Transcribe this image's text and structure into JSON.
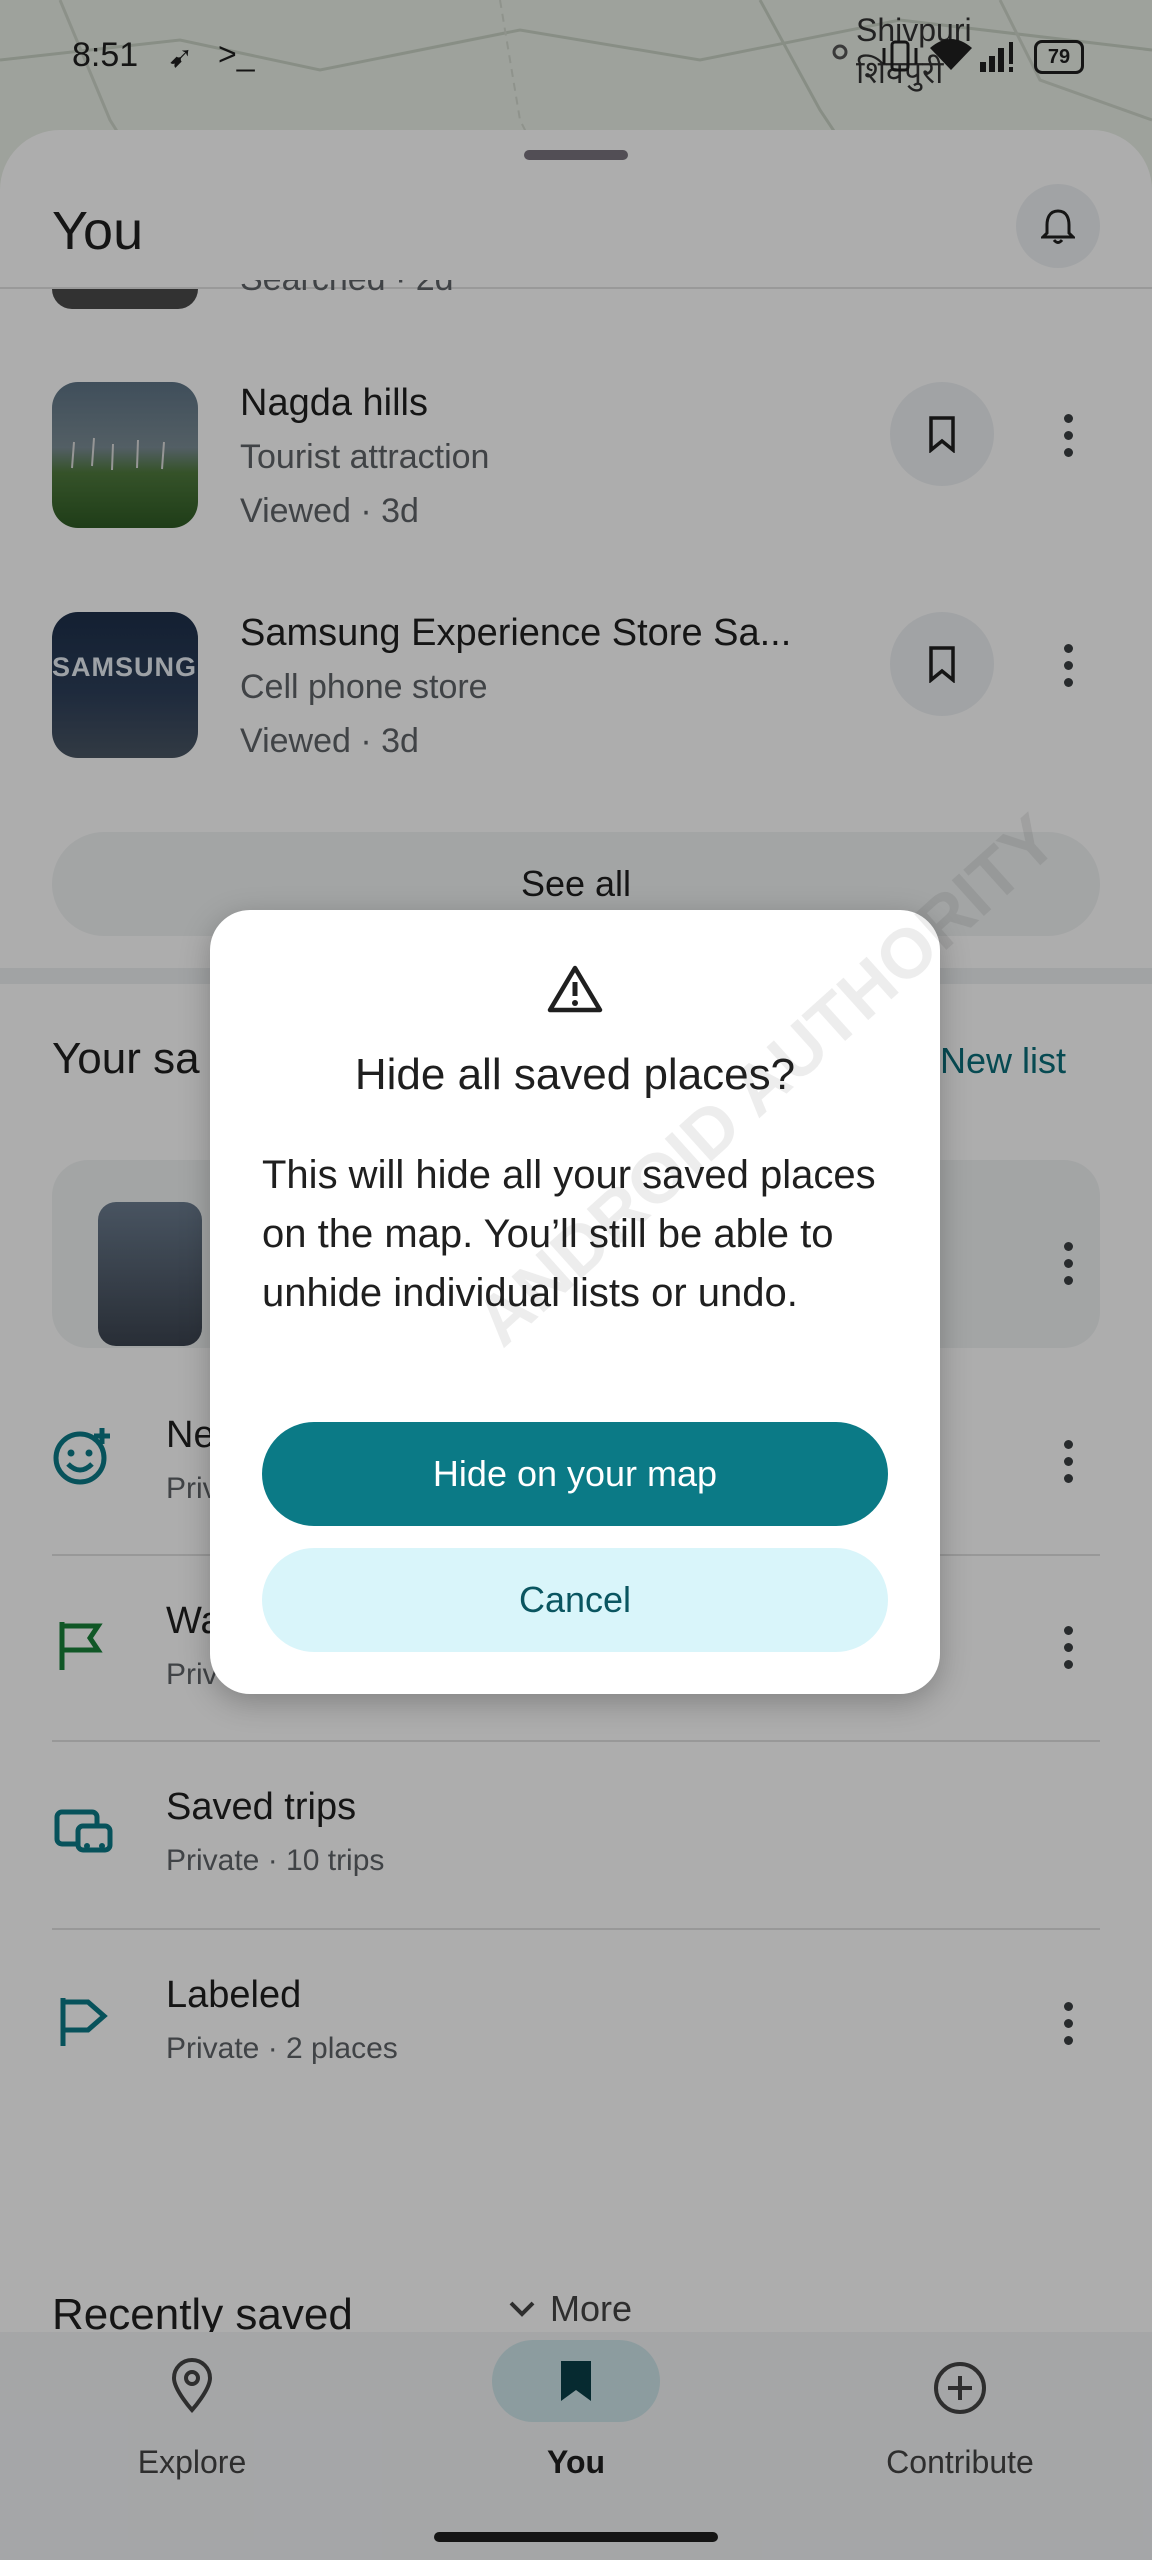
{
  "status_bar": {
    "time": "8:51",
    "battery": "79",
    "map_label_en": "Shivpuri",
    "map_label_hi": "शिवपुरी"
  },
  "header": {
    "title": "You"
  },
  "recent": {
    "partial_sub": "Searched · 2d",
    "items": [
      {
        "name": "Nagda hills",
        "category": "Tourist attraction",
        "meta": "Viewed · 3d"
      },
      {
        "name": "Samsung Experience Store Sa...",
        "category": "Cell phone store",
        "meta": "Viewed · 3d",
        "thumb_text": "SAMSUNG"
      }
    ],
    "see_all": "See all"
  },
  "saved": {
    "title_partial": "Your sa",
    "new_list": "New list",
    "lists": [
      {
        "name_partial": "Ne",
        "sub_partial": "Priv"
      },
      {
        "name_partial": "Wa",
        "sub_partial": "Priv"
      },
      {
        "name": "Saved trips",
        "sub": "Private · 10 trips"
      },
      {
        "name": "Labeled",
        "sub": "Private · 2 places"
      }
    ],
    "more": "More",
    "recently_saved": "Recently saved"
  },
  "nav": {
    "explore": "Explore",
    "you": "You",
    "contribute": "Contribute"
  },
  "dialog": {
    "title": "Hide all saved places?",
    "body": "This will hide all your saved places on the map. You’ll still be able to unhide individual lists or undo.",
    "primary": "Hide on your map",
    "secondary": "Cancel",
    "watermark": "ANDROID AUTHORITY"
  },
  "colors": {
    "accent": "#0b7a86",
    "accent_light": "#d9f5fa",
    "green": "#188038"
  }
}
